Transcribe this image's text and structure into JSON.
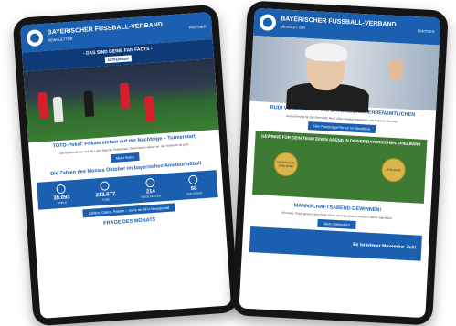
{
  "left_tablet": {
    "brand": "BAYERISCHER FUSSBALL-VERBAND",
    "brand_sub": "NEWSLETTER",
    "partner": "PARTNER",
    "banner_title": "- DAS SIND DEINE FAN FACTS -",
    "banner_badge": "NOVEMBER",
    "article_title": "TOTO-Pokal: Pokale stehen auf der Nachfolge – Turnierstart",
    "article_body": "Der Modus ist klar: Auf die Ligen folgt die Pokalrunde. Zwei Partien stehen an, die Vorfreude ist groß.",
    "article_button": "Mehr lesen",
    "stats_title": "Die Zahlen des Monats Oktober im bayerischen Amateurfußball",
    "stats": [
      {
        "num": "39.093",
        "label": "SPIELE"
      },
      {
        "num": "213.677",
        "label": "TORE"
      },
      {
        "num": "214",
        "label": "ROTE KARTEN"
      },
      {
        "num": "68",
        "label": "LIVETICKER"
      }
    ],
    "stats_button": "Zahlen, Daten, Fakten – mehr im BFV-Newsportal",
    "frage": "FRAGE DES MONATS"
  },
  "right_tablet": {
    "brand": "BAYERISCHER FUSSBALL-VERBAND",
    "brand_sub": "NEWSLETTER",
    "partner": "PARTNER",
    "article_title": "RUDI VÖLLER EHRT DIE BAYERISCHEN EHRENAMTLICHEN",
    "article_body": "Auszeichnung für das Ehrenamt: Rudi Völler würdigt Engagierte aus Bayerns Vereinen.",
    "article_button": "Hier Preisträger*innen im Überblick",
    "win_title": "GEWINNE FÜR DEIN TEAM EINEN ABEND IN DEINER BAYERISCHEN SPIELBANK",
    "medal_left": "BAYERISCHE SPIELBANK",
    "medal_right": "SPIELBANK",
    "team_title": "MANNSCHAFTSABEND GEWINNEN!",
    "team_body": "Mit etwas Glück gewinnt dein Team einen unvergesslichen Abend in deiner Spielbank.",
    "team_button": "Jetzt mitmachen",
    "movember": "Es ist wieder Movember-Zeit!"
  }
}
